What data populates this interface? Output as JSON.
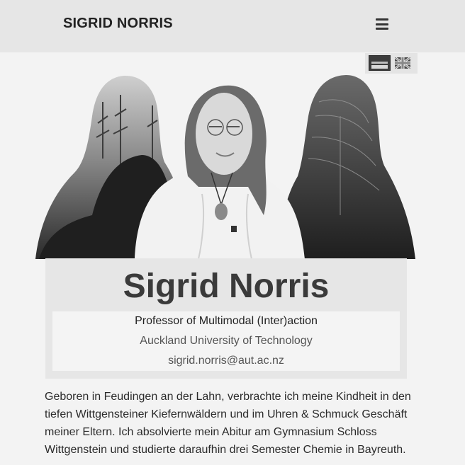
{
  "header": {
    "site_title": "SIGRID NORRIS",
    "menu_icon": "hamburger-menu-icon"
  },
  "language_switcher": {
    "options": [
      {
        "icon": "german-flag-icon",
        "active": true
      },
      {
        "icon": "uk-flag-icon",
        "active": false
      }
    ]
  },
  "hero": {
    "image": "portrait-silhouettes-collage"
  },
  "profile": {
    "name": "Sigrid Norris",
    "role": "Professor of Multimodal (Inter)action",
    "university": "Auckland University of Technology",
    "email": "sigrid.norris@aut.ac.nz"
  },
  "bio": {
    "text": "Geboren in Feudingen an der Lahn, verbrachte ich meine Kindheit in den tiefen Wittgensteiner Kiefernwäldern und im Uhren & Schmuck Geschäft meiner Eltern. Ich absolvierte mein Abitur am Gymnasium Schloss Wittgenstein und studierte daraufhin drei Semester Chemie in Bayreuth."
  }
}
